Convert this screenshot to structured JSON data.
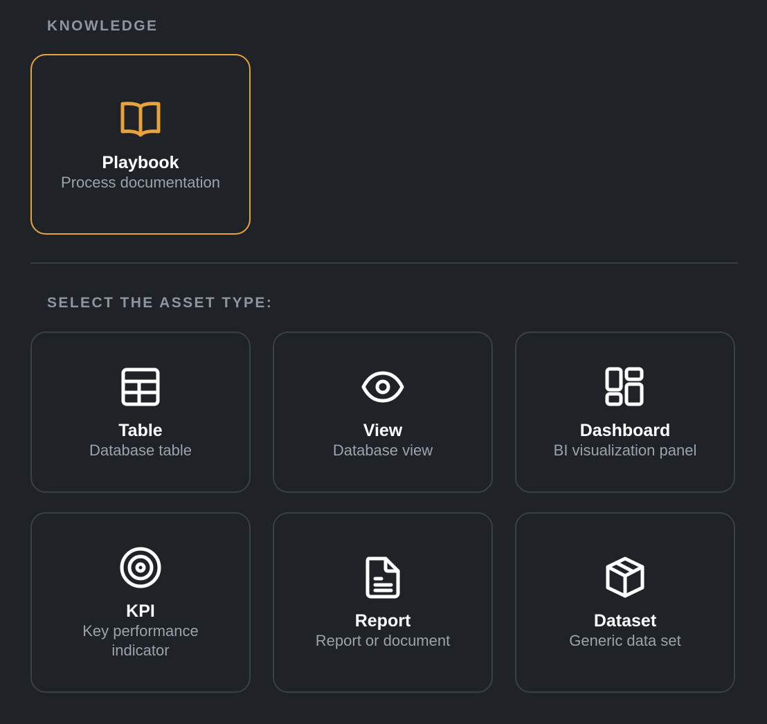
{
  "knowledge_section": {
    "heading": "KNOWLEDGE",
    "cards": [
      {
        "icon": "book-icon",
        "title": "Playbook",
        "description": "Process documentation",
        "selected": true
      }
    ]
  },
  "asset_section": {
    "heading": "SELECT THE ASSET TYPE:",
    "cards": [
      {
        "icon": "table-icon",
        "title": "Table",
        "description": "Database table"
      },
      {
        "icon": "eye-icon",
        "title": "View",
        "description": "Database view"
      },
      {
        "icon": "dashboard-icon",
        "title": "Dashboard",
        "description": "BI visualization panel"
      },
      {
        "icon": "target-icon",
        "title": "KPI",
        "description": "Key performance indicator"
      },
      {
        "icon": "document-icon",
        "title": "Report",
        "description": "Report or document"
      },
      {
        "icon": "box-icon",
        "title": "Dataset",
        "description": "Generic data set"
      }
    ]
  },
  "colors": {
    "background": "#1f2328",
    "accent": "#e8a33d",
    "card_border": "#3a4048",
    "heading": "#8b96a0"
  }
}
